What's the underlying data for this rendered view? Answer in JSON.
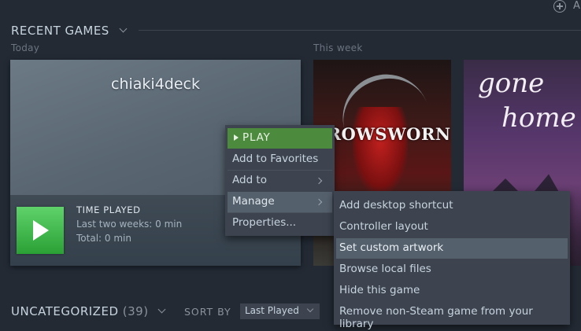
{
  "header": {
    "add_label": "A",
    "section_title": "RECENT GAMES"
  },
  "shelves": {
    "today_label": "Today",
    "week_label": "This week"
  },
  "main_tile": {
    "title": "chiaki4deck",
    "time_played_title": "TIME PLAYED",
    "last_two_weeks": "Last two weeks: 0 min",
    "total": "Total: 0 min"
  },
  "posters": [
    {
      "title": "CROWSWORN"
    },
    {
      "title_line1": "gone",
      "title_line2": "home"
    }
  ],
  "context_menu": {
    "items": [
      {
        "label": "PLAY"
      },
      {
        "label": "Add to Favorites"
      },
      {
        "label": "Add to"
      },
      {
        "label": "Manage"
      },
      {
        "label": "Properties..."
      }
    ]
  },
  "manage_submenu": {
    "items": [
      {
        "label": "Add desktop shortcut"
      },
      {
        "label": "Controller layout"
      },
      {
        "label": "Set custom artwork"
      },
      {
        "label": "Browse local files"
      },
      {
        "label": "Hide this game"
      },
      {
        "label": "Remove non-Steam game from your library"
      }
    ]
  },
  "bottom_bar": {
    "collection_label": "UNCATEGORIZED",
    "collection_count": "(39)",
    "sort_label": "SORT BY",
    "sort_value": "Last Played"
  },
  "colors": {
    "background": "#232a34",
    "menu_bg": "#3d4450",
    "play_green": "#4c8b3d",
    "highlight": "#55606d"
  }
}
